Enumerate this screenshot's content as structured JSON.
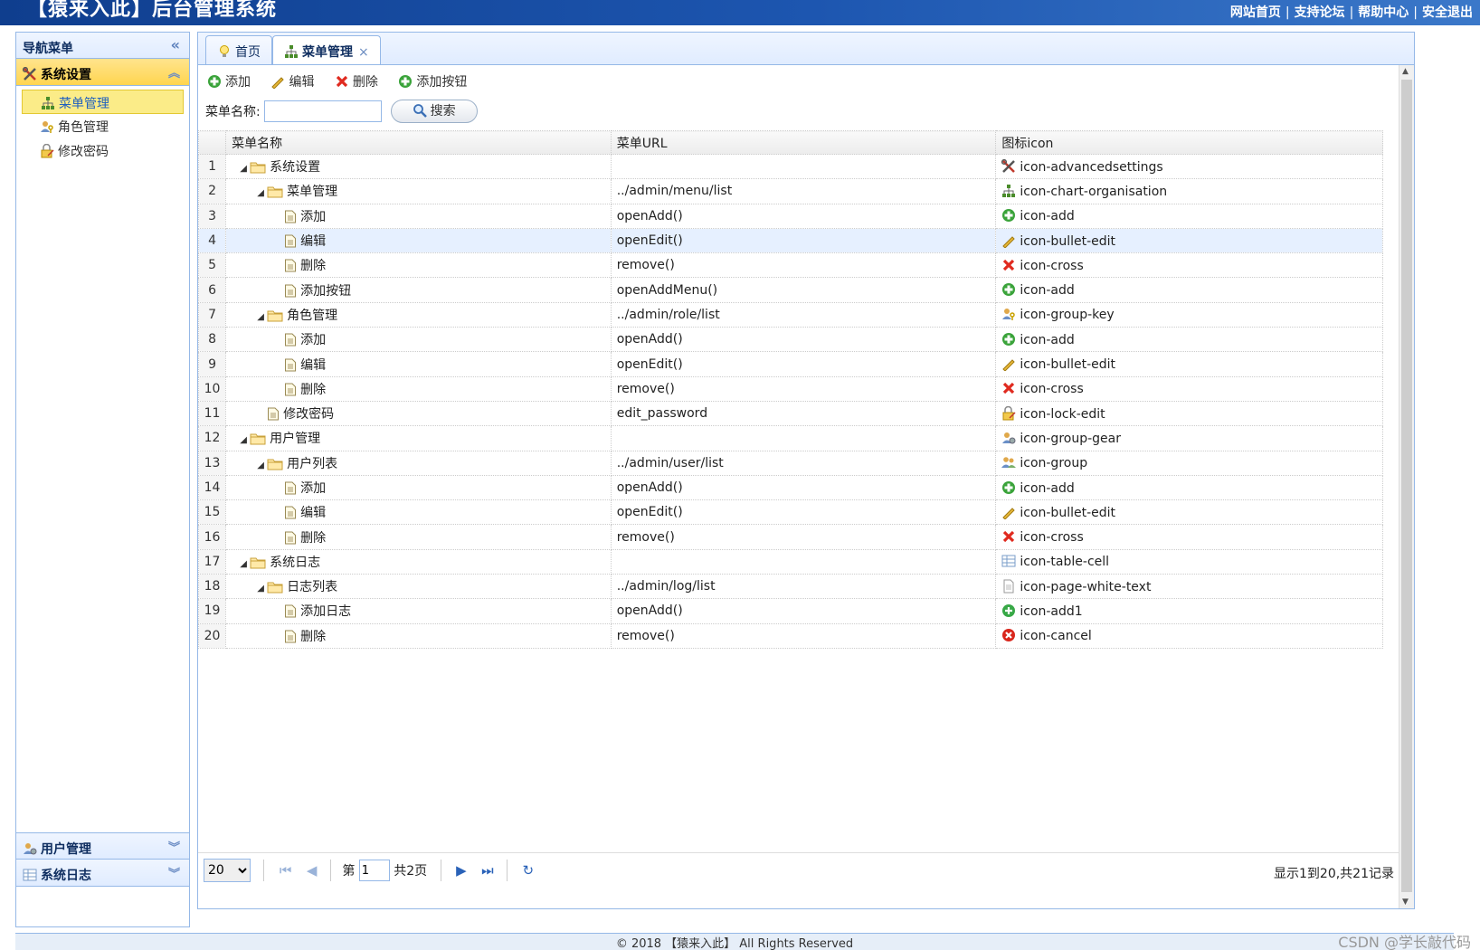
{
  "header": {
    "title": "【猿来入此】后台管理系统",
    "links": [
      "网站首页",
      "支持论坛",
      "帮助中心",
      "安全退出"
    ],
    "separator": "|"
  },
  "sidebar": {
    "title": "导航菜单",
    "groups": [
      {
        "label": "系统设置",
        "icon": "advanced-settings-icon",
        "items": [
          {
            "label": "菜单管理",
            "icon": "chart-organisation-icon",
            "selected": true
          },
          {
            "label": "角色管理",
            "icon": "group-key-icon"
          },
          {
            "label": "修改密码",
            "icon": "lock-edit-icon"
          }
        ]
      },
      {
        "label": "用户管理",
        "icon": "group-gear-icon"
      },
      {
        "label": "系统日志",
        "icon": "table-cell-icon"
      }
    ]
  },
  "tabs": [
    {
      "label": "首页",
      "icon": "lightbulb-icon"
    },
    {
      "label": "菜单管理",
      "icon": "chart-organisation-icon",
      "close": "×"
    }
  ],
  "toolbar": {
    "add": "添加",
    "edit": "编辑",
    "delete": "删除",
    "add_button": "添加按钮"
  },
  "search": {
    "label": "菜单名称:",
    "value": "",
    "button": "搜索"
  },
  "grid": {
    "columns": [
      "菜单名称",
      "菜单URL",
      "图标icon"
    ],
    "rows": [
      {
        "n": "1",
        "level": 0,
        "folder": true,
        "name": "系统设置",
        "url": "",
        "icon": "icon-advancedsettings"
      },
      {
        "n": "2",
        "level": 1,
        "folder": true,
        "name": "菜单管理",
        "url": "../admin/menu/list",
        "icon": "icon-chart-organisation"
      },
      {
        "n": "3",
        "level": 2,
        "folder": false,
        "name": "添加",
        "url": "openAdd()",
        "icon": "icon-add"
      },
      {
        "n": "4",
        "level": 2,
        "folder": false,
        "name": "编辑",
        "url": "openEdit()",
        "icon": "icon-bullet-edit"
      },
      {
        "n": "5",
        "level": 2,
        "folder": false,
        "name": "删除",
        "url": "remove()",
        "icon": "icon-cross"
      },
      {
        "n": "6",
        "level": 2,
        "folder": false,
        "name": "添加按钮",
        "url": "openAddMenu()",
        "icon": "icon-add"
      },
      {
        "n": "7",
        "level": 1,
        "folder": true,
        "name": "角色管理",
        "url": "../admin/role/list",
        "icon": "icon-group-key"
      },
      {
        "n": "8",
        "level": 2,
        "folder": false,
        "name": "添加",
        "url": "openAdd()",
        "icon": "icon-add"
      },
      {
        "n": "9",
        "level": 2,
        "folder": false,
        "name": "编辑",
        "url": "openEdit()",
        "icon": "icon-bullet-edit"
      },
      {
        "n": "10",
        "level": 2,
        "folder": false,
        "name": "删除",
        "url": "remove()",
        "icon": "icon-cross"
      },
      {
        "n": "11",
        "level": 1,
        "folder": false,
        "name": "修改密码",
        "url": "edit_password",
        "icon": "icon-lock-edit"
      },
      {
        "n": "12",
        "level": 0,
        "folder": true,
        "name": "用户管理",
        "url": "",
        "icon": "icon-group-gear"
      },
      {
        "n": "13",
        "level": 1,
        "folder": true,
        "name": "用户列表",
        "url": "../admin/user/list",
        "icon": "icon-group"
      },
      {
        "n": "14",
        "level": 2,
        "folder": false,
        "name": "添加",
        "url": "openAdd()",
        "icon": "icon-add"
      },
      {
        "n": "15",
        "level": 2,
        "folder": false,
        "name": "编辑",
        "url": "openEdit()",
        "icon": "icon-bullet-edit"
      },
      {
        "n": "16",
        "level": 2,
        "folder": false,
        "name": "删除",
        "url": "remove()",
        "icon": "icon-cross"
      },
      {
        "n": "17",
        "level": 0,
        "folder": true,
        "name": "系统日志",
        "url": "",
        "icon": "icon-table-cell"
      },
      {
        "n": "18",
        "level": 1,
        "folder": true,
        "name": "日志列表",
        "url": "../admin/log/list",
        "icon": "icon-page-white-text"
      },
      {
        "n": "19",
        "level": 2,
        "folder": false,
        "name": "添加日志",
        "url": "openAdd()",
        "icon": "icon-add1"
      },
      {
        "n": "20",
        "level": 2,
        "folder": false,
        "name": "删除",
        "url": "remove()",
        "icon": "icon-cancel"
      }
    ],
    "hover_row": 4
  },
  "pager": {
    "page_size": "20",
    "page_prefix": "第",
    "page": "1",
    "total_pages": "共2页",
    "summary": "显示1到20,共21记录"
  },
  "footer": {
    "copyright": "© 2018 【猿来入此】 All Rights Reserved"
  },
  "watermark": "CSDN @学长敲代码",
  "colors": {
    "header_blue": "#1d56b0",
    "border_blue": "#95b8e7",
    "active_yellow": "#ffd54f",
    "add_green": "#2e9a2e",
    "cross_red": "#e02a1f"
  }
}
